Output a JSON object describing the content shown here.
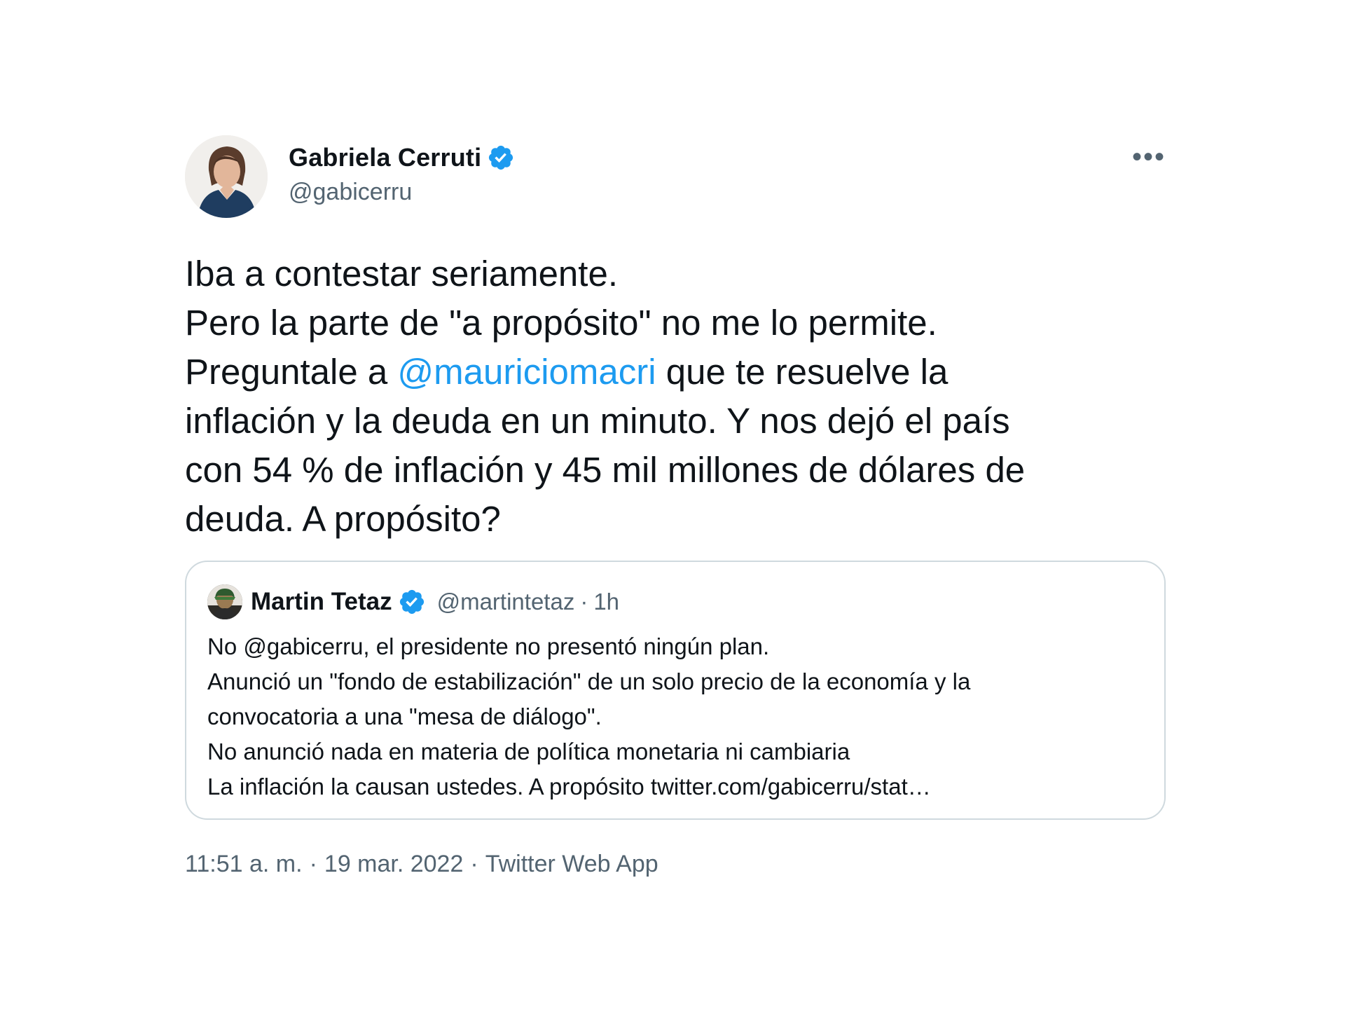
{
  "tweet": {
    "author_name": "Gabriela Cerruti",
    "author_handle": "@gabicerru",
    "more_label": "•••",
    "text_lines": [
      {
        "text": "Iba a contestar seriamente."
      },
      {
        "text": "Pero la parte de \"a propósito\" no me lo permite."
      },
      {
        "pre": "Preguntale a ",
        "mention": "@mauriciomacri",
        "post": " que te resuelve la"
      },
      {
        "text": "inflación y la deuda en un minuto. Y nos dejó el país"
      },
      {
        "text": "con 54 % de inflación y 45 mil millones de dólares de"
      },
      {
        "text": "deuda. A propósito?"
      }
    ]
  },
  "quote": {
    "author_name": "Martin Tetaz",
    "author_handle": "@martintetaz",
    "separator": "·",
    "time": "1h",
    "text": "No @gabicerru, el presidente no presentó ningún plan.\nAnunció un \"fondo de estabilización\" de un solo precio de la economía y la\nconvocatoria a una \"mesa de diálogo\".\nNo anunció nada en materia de política monetaria ni cambiaria\nLa inflación la causan ustedes. A propósito twitter.com/gabicerru/stat…"
  },
  "meta": {
    "time": "11:51 a. m.",
    "sep1": "·",
    "date": "19 mar. 2022",
    "sep2": "·",
    "source": "Twitter Web App"
  },
  "colors": {
    "accent": "#1d9bf0",
    "text": "#0f1419",
    "secondary": "#536471",
    "border": "#cfd9de"
  }
}
